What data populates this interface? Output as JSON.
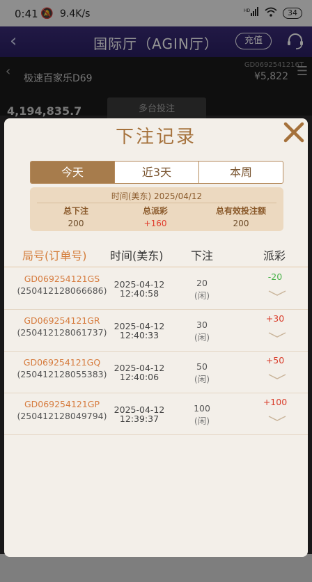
{
  "status_bar": {
    "time": "0:41",
    "mute_icon": "bell-off-icon",
    "speed": "9.4K/s",
    "network": "HD",
    "battery": "34"
  },
  "header": {
    "title": "国际厅（AGIN厅）",
    "recharge_label": "充值",
    "support_icon": "headset-icon"
  },
  "game_background": {
    "table_name": "极速百家乐D69",
    "table_id": "GD0692541216T",
    "balance": "¥5,822",
    "amount": "4,194,835.7",
    "multi_bet_label": "多台投注"
  },
  "modal": {
    "title": "下注记录",
    "tabs": [
      {
        "label": "今天",
        "active": true
      },
      {
        "label": "近3天",
        "active": false
      },
      {
        "label": "本周",
        "active": false
      }
    ],
    "summary": {
      "time_label": "时间(美东)  2025/04/12",
      "total_bet_label": "总下注",
      "total_bet_value": "200",
      "total_payout_label": "总派彩",
      "total_payout_value": "+160",
      "valid_bet_label": "总有效投注额",
      "valid_bet_value": "200"
    },
    "columns": {
      "order": "局号(订单号)",
      "time": "时间(美东)",
      "bet": "下注",
      "payout": "派彩"
    },
    "rows": [
      {
        "order": "GD069254121GS",
        "order_no": "(250412128066686)",
        "date": "2025-04-12",
        "time": "12:40:58",
        "bet": "20",
        "side": "(闲)",
        "payout": "-20"
      },
      {
        "order": "GD069254121GR",
        "order_no": "(250412128061737)",
        "date": "2025-04-12",
        "time": "12:40:33",
        "bet": "30",
        "side": "(闲)",
        "payout": "+30"
      },
      {
        "order": "GD069254121GQ",
        "order_no": "(250412128055383)",
        "date": "2025-04-12",
        "time": "12:40:06",
        "bet": "50",
        "side": "(闲)",
        "payout": "+50"
      },
      {
        "order": "GD069254121GP",
        "order_no": "(250412128049794)",
        "date": "2025-04-12",
        "time": "12:39:37",
        "bet": "100",
        "side": "(闲)",
        "payout": "+100"
      }
    ]
  },
  "colors": {
    "header_bg": "#2f2370",
    "accent_gold": "#a77c4c",
    "negative": "#49b34a",
    "positive": "#d93d2b"
  }
}
